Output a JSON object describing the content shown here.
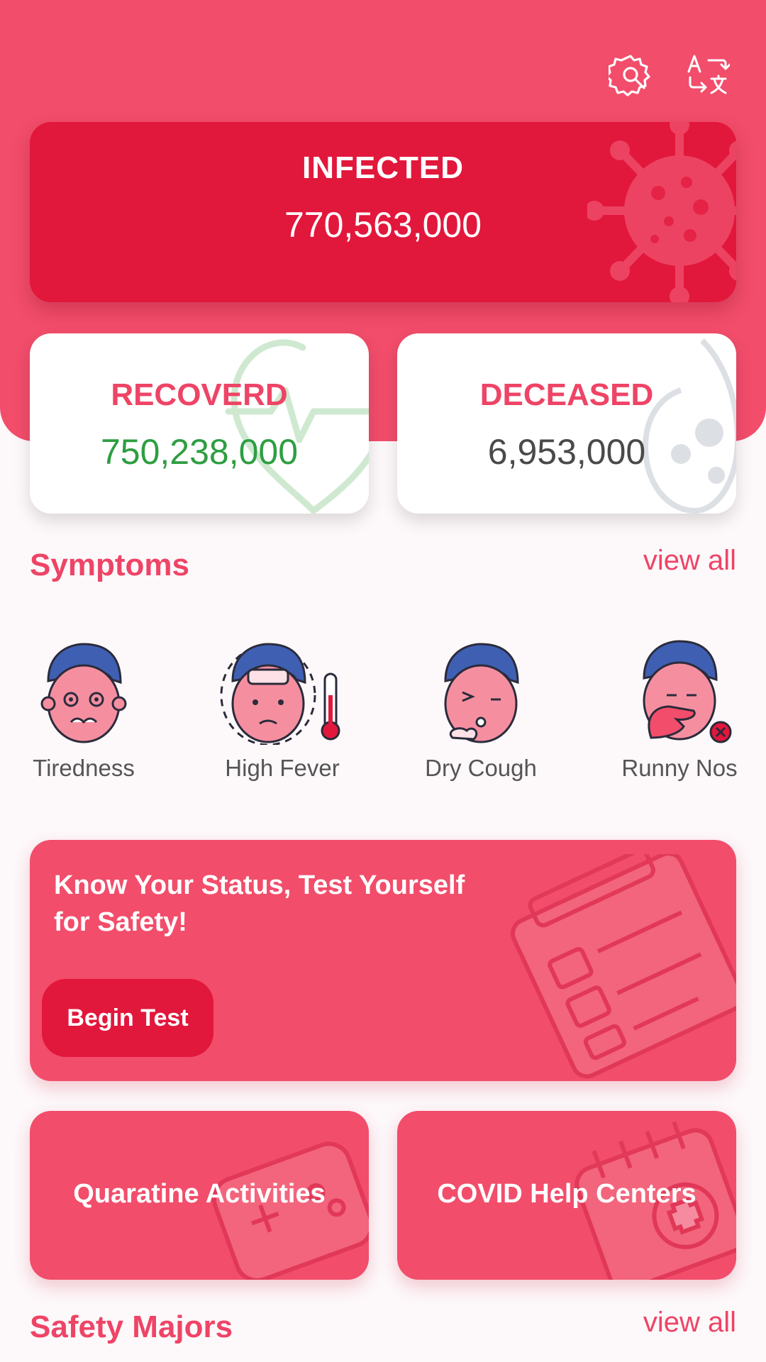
{
  "stats": {
    "infected": {
      "title": "INFECTED",
      "value": "770,563,000"
    },
    "recovered": {
      "title": "RECOVERD",
      "value": "750,238,000",
      "color": "#2e9e41"
    },
    "deceased": {
      "title": "DECEASED",
      "value": "6,953,000",
      "color": "#4a4a4a"
    }
  },
  "symptoms": {
    "title": "Symptoms",
    "view_all": "view all",
    "items": [
      {
        "label": "Tiredness",
        "icon": "tiredness-face-icon"
      },
      {
        "label": "High Fever",
        "icon": "fever-face-icon"
      },
      {
        "label": "Dry Cough",
        "icon": "cough-face-icon"
      },
      {
        "label": "Runny Nos",
        "icon": "runny-nose-face-icon"
      }
    ]
  },
  "test_banner": {
    "headline": "Know Your Status, Test Yourself for Safety!",
    "button": "Begin Test"
  },
  "cards": {
    "quarantine": "Quaratine Activities",
    "help_centers": "COVID Help Centers"
  },
  "safety": {
    "title": "Safety Majors",
    "view_all": "view all"
  },
  "colors": {
    "primary": "#f24d6b",
    "dark_primary": "#e2173c",
    "background": "#fdf8fa"
  },
  "icons": {
    "settings": "settings-gear-wrench-icon",
    "language": "translate-icon"
  }
}
